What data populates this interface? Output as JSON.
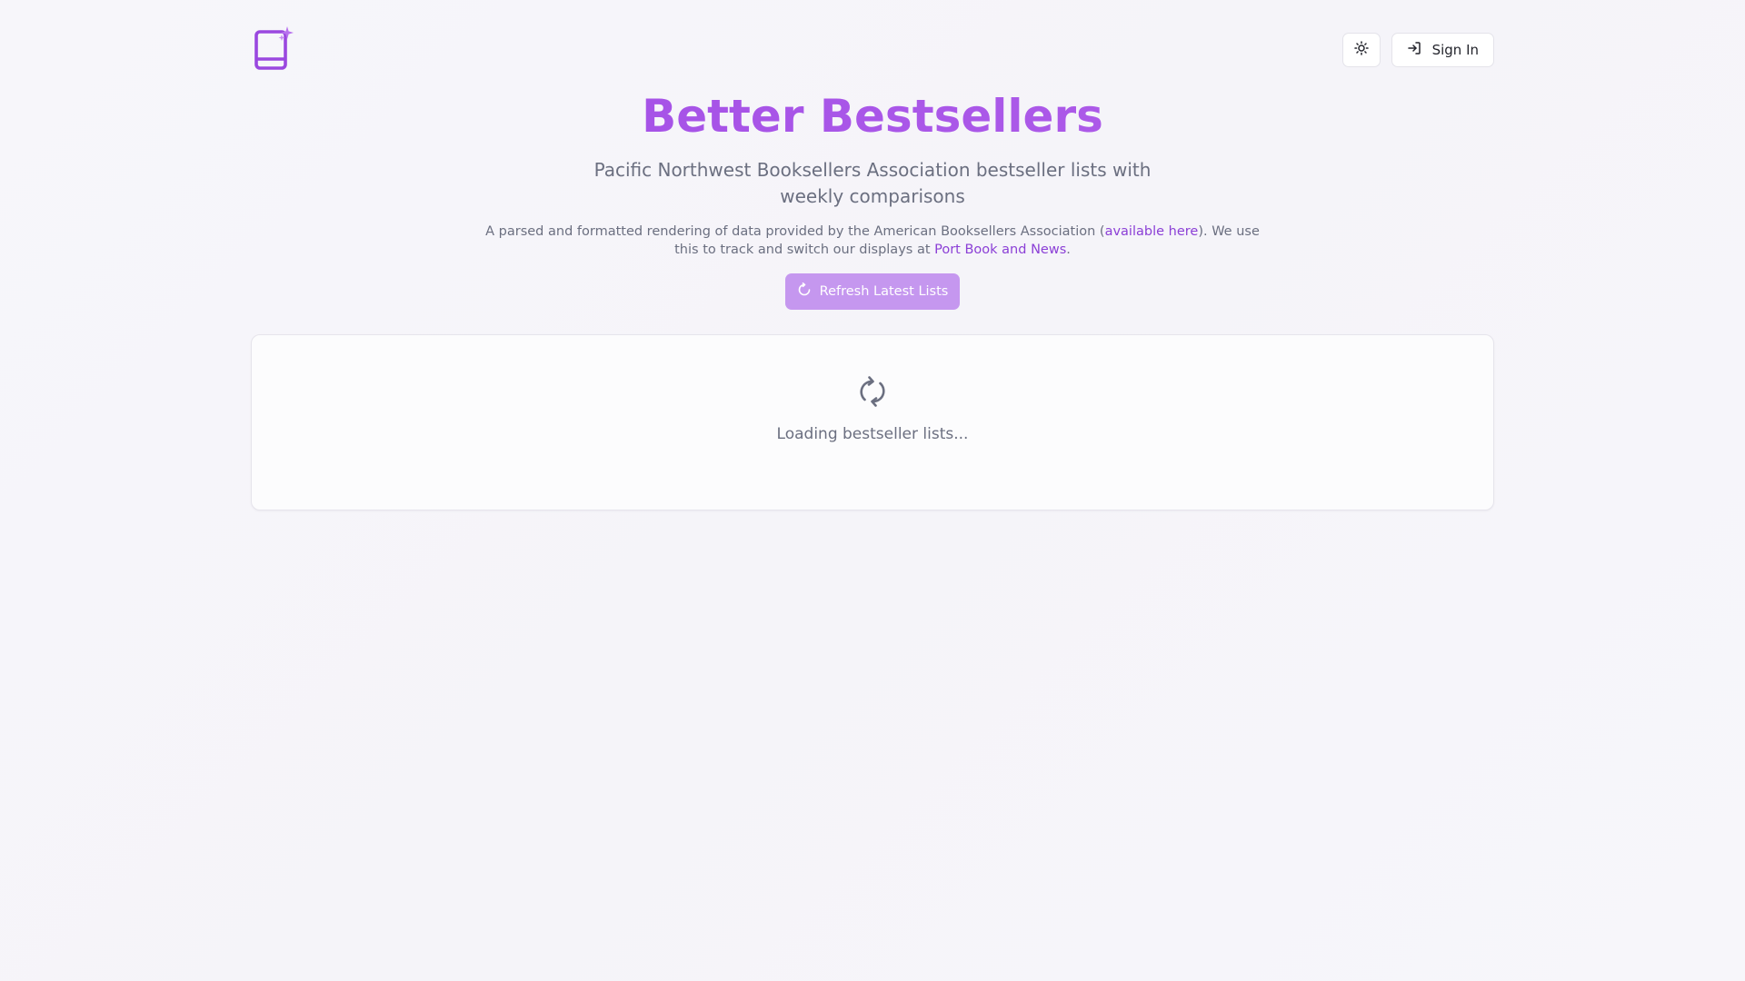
{
  "header": {
    "logo_icon": "book-sparkle-icon",
    "theme_toggle_icon": "sun-icon",
    "signin_icon": "sign-in-icon",
    "signin_label": "Sign In"
  },
  "hero": {
    "title": "Better Bestsellers",
    "subtitle": "Pacific Northwest Booksellers Association bestseller lists with weekly comparisons",
    "desc_before_link1": "A parsed and formatted rendering of data provided by the American Booksellers Association (",
    "link1": "available here",
    "desc_between_links": "). We use this to track and switch our displays at ",
    "link2": "Port Book and News",
    "desc_after_link2": ".",
    "refresh_icon": "refresh-icon",
    "refresh_label": "Refresh Latest Lists"
  },
  "loading": {
    "icon": "loading-spinner-icon",
    "text": "Loading bestseller lists..."
  },
  "colors": {
    "accent": "#a855e8",
    "link": "#8b3fd6",
    "button_bg": "#c597ef",
    "muted_text": "#6b6f80",
    "background": "#f7f6fa"
  }
}
